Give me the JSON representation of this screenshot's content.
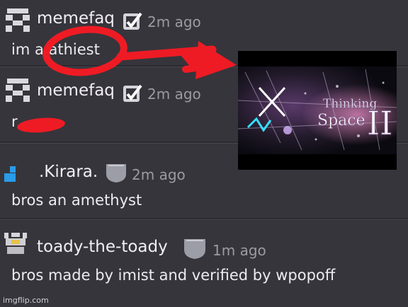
{
  "comments": [
    {
      "username": "memefaq",
      "time": "2m ago",
      "text": "im a athiest"
    },
    {
      "username": "memefaq",
      "time": "2m ago",
      "text": "r"
    },
    {
      "username": ".Kirara.",
      "time": "2m ago",
      "text": "bros an amethyst"
    },
    {
      "username": "toady-the-toady",
      "time": "1m ago",
      "text": "bros made by imist and verified by wpopoff"
    }
  ],
  "thumbnail": {
    "title_line1": "Thinking",
    "title_line2": "Space",
    "numeral": "II"
  },
  "watermark": "imgflip.com",
  "colors": {
    "background": "#36353b",
    "annotation": "#ee1b24",
    "kirara_icon": "#2a9be8"
  }
}
